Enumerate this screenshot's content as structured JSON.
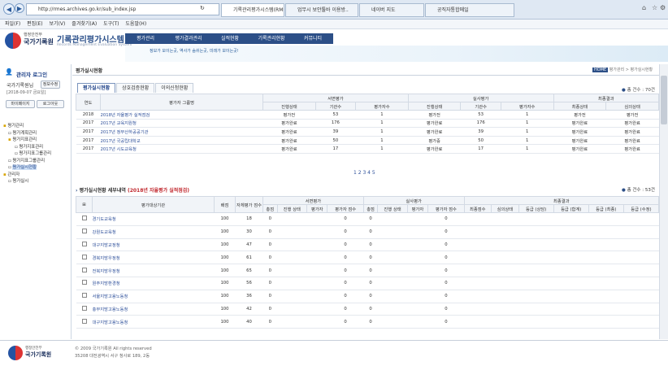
{
  "browser": {
    "url": "http://rmes.archives.go.kr/sub_index.jsp",
    "tabs": [
      "기록관리평가시스템(RMES)",
      "업무시 보안툴바 이용방..",
      "네이버 지도",
      "공직자통합메일"
    ],
    "menu": [
      "파일(F)",
      "편집(E)",
      "보기(V)",
      "즐겨찾기(A)",
      "도구(T)",
      "도움말(H)"
    ]
  },
  "header": {
    "org_small": "행정안전부",
    "org": "국가기록원",
    "system": "기록관리평가시스템",
    "system_sub": "Records Management Evaluation System",
    "nav": [
      "평가관리",
      "평가결과관리",
      "실적현황",
      "기록관리현황",
      "커뮤니티"
    ],
    "slogan": "정보가 모이는곳, 역사가 숨쉬는곳, 미래가 보이는곳!"
  },
  "sidebar": {
    "title": "관리자 로그인",
    "user": "국가기록원님",
    "info_btn": "정보수정",
    "date": "[2018-09-07 금요일]",
    "mypage": "마이페이지",
    "logout": "로그아웃",
    "tree": [
      "평가관리",
      "평가계획관리",
      "평가지표관리",
      "평가지표관리",
      "평가지표그룹관리",
      "평가지표그룹관리",
      "평가실시현황",
      "관리자",
      "평가실시"
    ]
  },
  "page": {
    "title": "평가실시현황",
    "breadcrumb": "평가관리 > 평가실시현황",
    "home": "HOME"
  },
  "tabs": [
    "평가실시현황",
    "상호검증현황",
    "이의신청현황"
  ],
  "summary": {
    "total": "총 건수 : 70건",
    "tab_title": "평가실시현황 세부내역",
    "subtitle": "(2018년 자율평가 실적점검)",
    "total2": "총 건수 : 53건"
  },
  "table1": {
    "headers": {
      "year": "연도",
      "group": "평가자 그룹명",
      "doc": "서면평가",
      "site": "실사평가",
      "final": "최종결과",
      "status": "진행상태",
      "orgs": "기관수",
      "evaluators": "평가자수",
      "fstatus": "최종상태",
      "review": "심의상태"
    },
    "rows": [
      [
        "2018",
        "2018년 자율평가 실적점검",
        "평가전",
        "53",
        "1",
        "평가전",
        "53",
        "1",
        "평가전",
        "평가전"
      ],
      [
        "2017",
        "2017년 교육지원청",
        "평가완료",
        "176",
        "1",
        "평가완료",
        "176",
        "1",
        "평가완료",
        "평가완료"
      ],
      [
        "2017",
        "2017년 정부산하공공기관",
        "평가완료",
        "39",
        "1",
        "평가완료",
        "39",
        "1",
        "평가완료",
        "평가완료"
      ],
      [
        "2017",
        "2017년 국공립대학교",
        "평가완료",
        "50",
        "1",
        "평가중",
        "50",
        "1",
        "평가완료",
        "평가완료"
      ],
      [
        "2017",
        "2017년 시도교육청",
        "평가완료",
        "17",
        "1",
        "평가완료",
        "17",
        "1",
        "평가완료",
        "평가완료"
      ]
    ],
    "pager": "1 2 3 4 5"
  },
  "table2": {
    "headers": {
      "org": "평가대상기관",
      "weight": "배점",
      "count": "자체평가 점수",
      "doc": "서면평가",
      "site": "실사평가",
      "final": "최종결과",
      "total": "총점",
      "status": "진행 상태",
      "evaluator": "평가자",
      "eval_score": "평가자 점수",
      "fscore": "최종점수",
      "review": "심의상태",
      "g1": "등급 (상담)",
      "g2": "등급 (합계)",
      "g3": "등급 (최종)",
      "g4": "등급 (수정)"
    },
    "rows": [
      [
        "경기도교육청",
        "100",
        "18",
        "0",
        "0",
        "0",
        "0"
      ],
      [
        "강원도교육청",
        "100",
        "30",
        "0",
        "0",
        "0",
        "0"
      ],
      [
        "대구지방교정청",
        "100",
        "47",
        "0",
        "0",
        "0",
        "0"
      ],
      [
        "경북지방우정청",
        "100",
        "61",
        "0",
        "0",
        "0",
        "0"
      ],
      [
        "전북지방우정청",
        "100",
        "65",
        "0",
        "0",
        "0",
        "0"
      ],
      [
        "원주지방환경청",
        "100",
        "56",
        "0",
        "0",
        "0",
        "0"
      ],
      [
        "서울지방고용노동청",
        "100",
        "36",
        "0",
        "0",
        "0",
        "0"
      ],
      [
        "충부지방고용노동청",
        "100",
        "42",
        "0",
        "0",
        "0",
        "0"
      ],
      [
        "대구지방고용노동청",
        "100",
        "40",
        "0",
        "0",
        "0",
        "0"
      ]
    ]
  },
  "footer": {
    "copy": "© 2009 국가기록원 All rights reserved",
    "addr": "35208 대전광역시 서구 청사로 189, 2동"
  }
}
